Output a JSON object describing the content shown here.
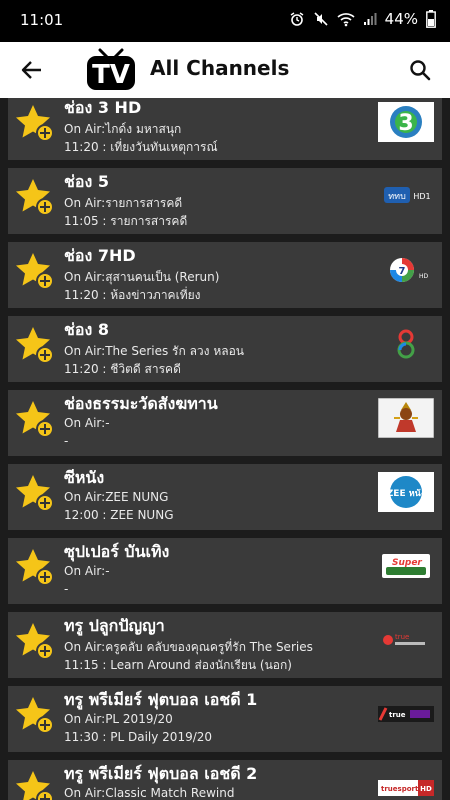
{
  "status_bar": {
    "time": "11:01",
    "battery": "44%"
  },
  "app_bar": {
    "title": "All Channels",
    "logo_text": "TV"
  },
  "channels": [
    {
      "name": "ช่อง 3 HD",
      "on_air_label": "On Air:",
      "on_air": "ไกด์ง มหาสนุก",
      "schedule": "11:20 : เที่ยงวันทันเหตุการณ์"
    },
    {
      "name": "ช่อง 5",
      "on_air_label": "On Air:",
      "on_air": "รายการสารคดี",
      "schedule": "11:05 : รายการสารคดี"
    },
    {
      "name": "ช่อง 7HD",
      "on_air_label": "On Air:",
      "on_air": "สุสานคนเป็น (Rerun)",
      "schedule": "11:20 : ห้องข่าวภาคเที่ยง"
    },
    {
      "name": "ช่อง 8",
      "on_air_label": "On Air:",
      "on_air": "The Series รัก ลวง หลอน",
      "schedule": "11:20 : ชีวิตดี สารคดี"
    },
    {
      "name": "ช่องธรรมะวัดสังฆทาน",
      "on_air_label": "On Air:",
      "on_air": "-",
      "schedule": "-"
    },
    {
      "name": "ซีหนัง",
      "on_air_label": "On Air:",
      "on_air": "ZEE NUNG",
      "schedule": "12:00 : ZEE NUNG"
    },
    {
      "name": "ซุปเปอร์ บันเทิง",
      "on_air_label": "On Air:",
      "on_air": "-",
      "schedule": "-"
    },
    {
      "name": "ทรู ปลูกปัญญา",
      "on_air_label": "On Air:",
      "on_air": "ครูคลับ คลับของคุณครูที่รัก The Series",
      "schedule": "11:15 : Learn Around ส่องนักเรียน (นอก)"
    },
    {
      "name": "ทรู พรีเมียร์ ฟุตบอล เอชดี 1",
      "on_air_label": "On Air:",
      "on_air": "PL 2019/20",
      "schedule": "11:30 : PL Daily 2019/20"
    },
    {
      "name": "ทรู พรีเมียร์ ฟุตบอล เอชดี 2",
      "on_air_label": "On Air:",
      "on_air": "Classic Match Rewind",
      "schedule": ""
    }
  ],
  "logos": {
    "ch7": "7",
    "ch8": "8",
    "zee": "ZEE หนัง",
    "super": "Super",
    "truesports": "truesports",
    "hd": "HD",
    "hd1": "HD1",
    "mcot": "ททบ",
    "truehd": "true"
  },
  "colors": {
    "star": "#f5c518",
    "row_bg": "#3a3a3a",
    "list_bg": "#1c1c1c"
  }
}
